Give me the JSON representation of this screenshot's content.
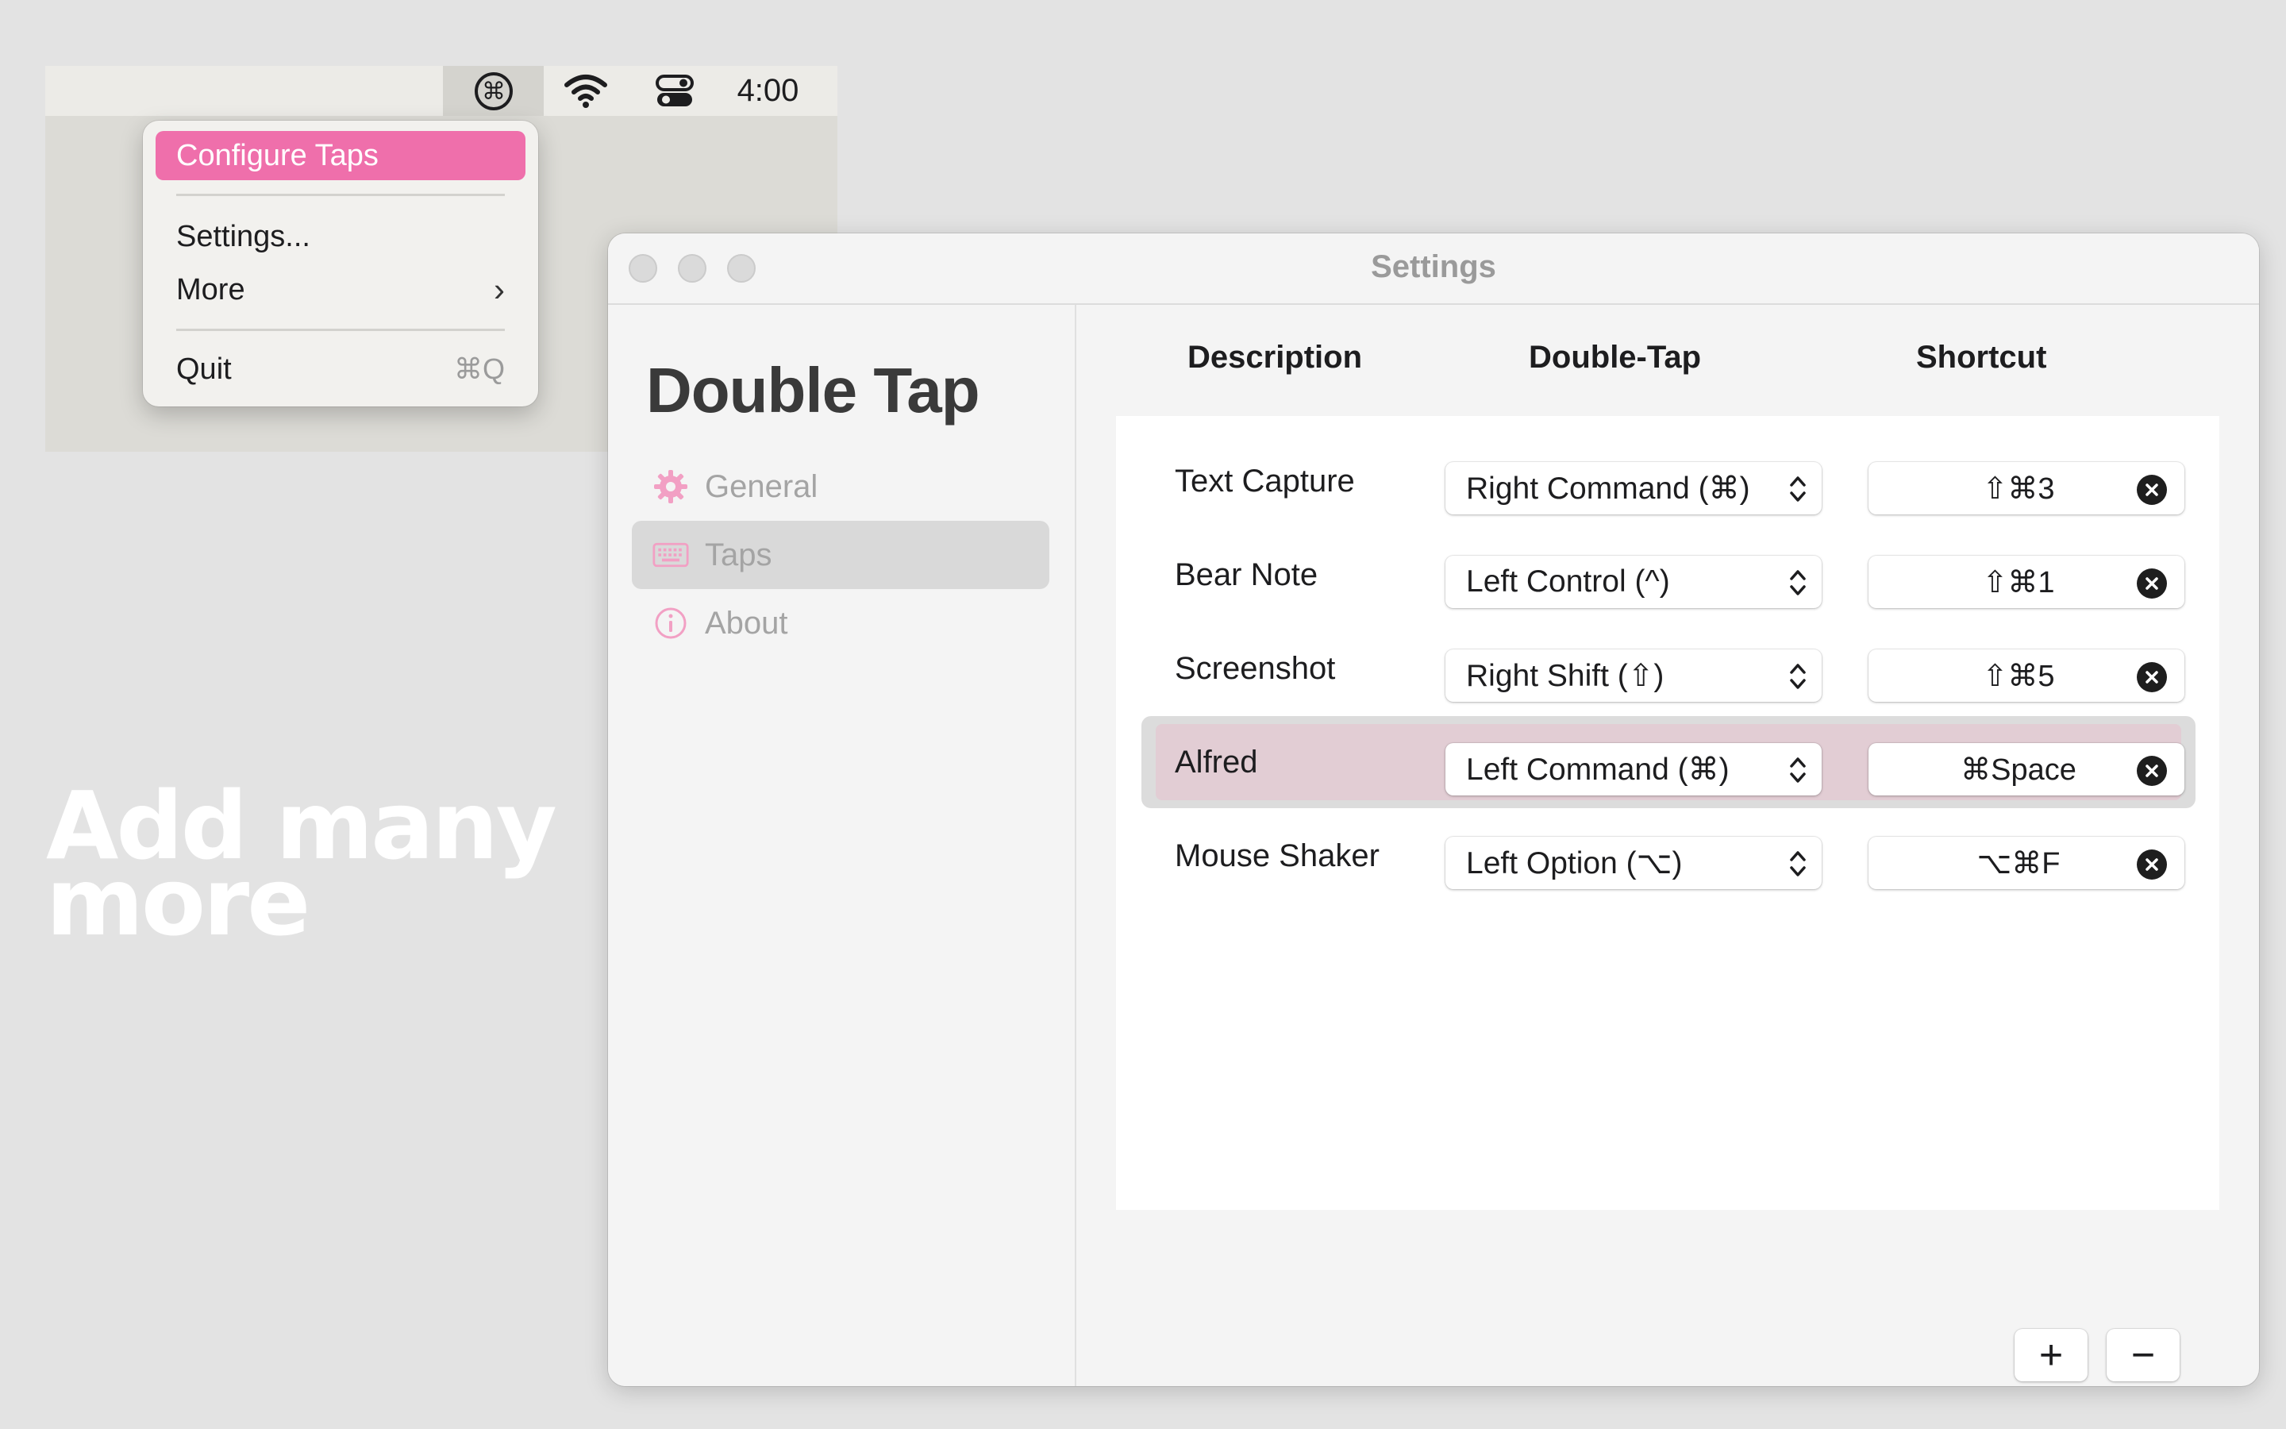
{
  "menubar": {
    "icons": [
      "command-icon",
      "wifi-icon",
      "control-center-icon"
    ],
    "clock": "4:00"
  },
  "menu": {
    "configure_label": "Configure Taps",
    "settings_label": "Settings...",
    "more_label": "More",
    "quit_label": "Quit",
    "quit_shortcut": "⌘Q"
  },
  "headline": {
    "line1": "Add many",
    "line2": "more"
  },
  "window": {
    "title": "Settings"
  },
  "sidebar": {
    "app_title": "Double Tap",
    "items": [
      {
        "label": "General",
        "icon": "gear-icon"
      },
      {
        "label": "Taps",
        "icon": "keyboard-icon"
      },
      {
        "label": "About",
        "icon": "info-icon"
      }
    ],
    "selected": "Taps"
  },
  "table": {
    "headers": [
      "Description",
      "Double-Tap",
      "Shortcut"
    ],
    "rows": [
      {
        "description": "Text Capture",
        "double_tap": "Right Command (⌘)",
        "shortcut": "⇧⌘3"
      },
      {
        "description": "Bear Note",
        "double_tap": "Left Control (^)",
        "shortcut": "⇧⌘1"
      },
      {
        "description": "Screenshot",
        "double_tap": "Right Shift (⇧)",
        "shortcut": "⇧⌘5"
      },
      {
        "description": "Alfred",
        "double_tap": "Left Command (⌘)",
        "shortcut": "⌘Space"
      },
      {
        "description": "Mouse Shaker",
        "double_tap": "Left Option (⌥)",
        "shortcut": "⌥⌘F"
      }
    ],
    "selected_row": "Alfred"
  },
  "toolbar": {
    "add_label": "+",
    "remove_label": "−"
  },
  "colors": {
    "accent": "#ef6fab",
    "selected_row": "#e2cdd4",
    "sidebar_icon": "#f2a0c4"
  }
}
